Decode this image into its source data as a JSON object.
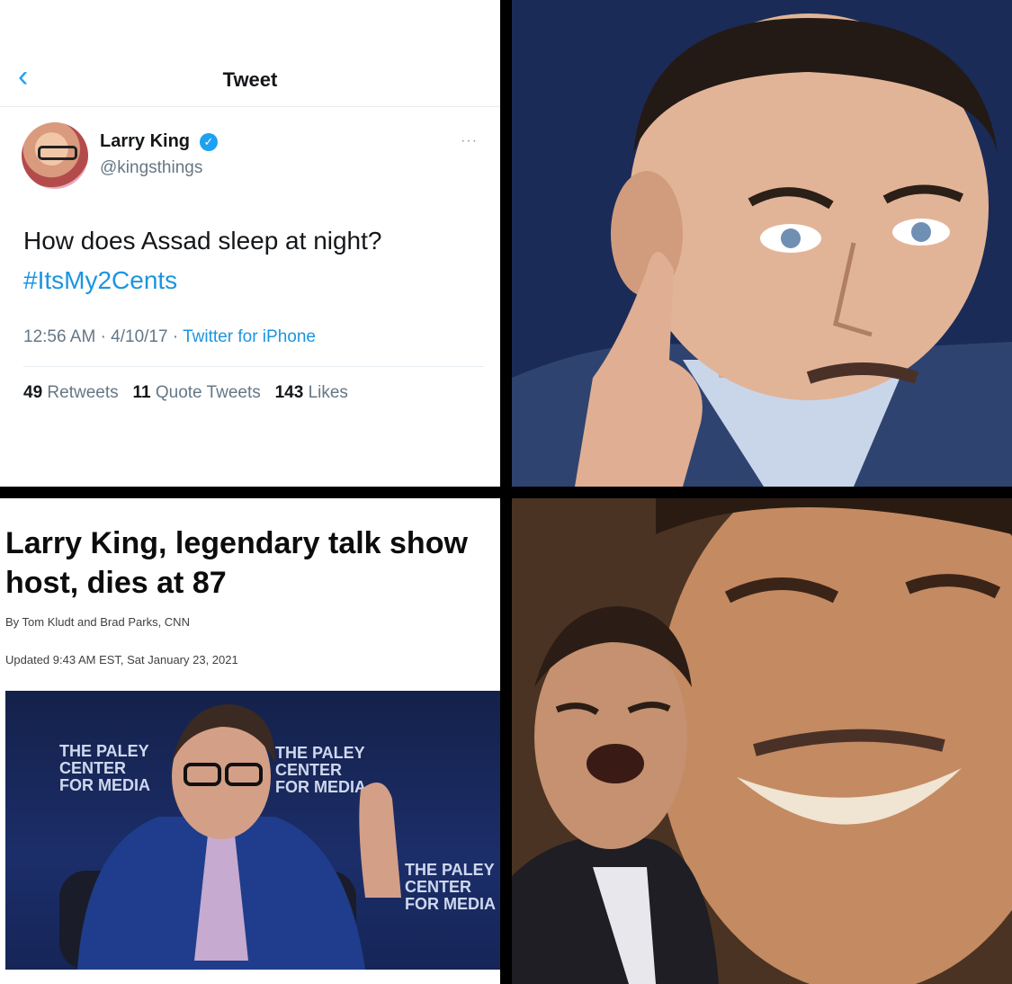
{
  "tweet": {
    "nav_title": "Tweet",
    "back_icon": "chevron-left-icon",
    "user_name": "Larry King",
    "verified_icon": "verified-badge-icon",
    "handle": "@kingsthings",
    "more_icon": "more-dots-icon",
    "more_glyph": "···",
    "text": "How does Assad sleep at night?",
    "hashtag": "#ItsMy2Cents",
    "time": "12:56 AM",
    "date": "4/10/17",
    "source": "Twitter for iPhone",
    "retweets_count": "49",
    "retweets_label": "Retweets",
    "quote_count": "11",
    "quote_label": "Quote Tweets",
    "likes_count": "143",
    "likes_label": "Likes",
    "accent_color": "#1da1f2"
  },
  "article": {
    "headline": "Larry King, legendary talk show host, dies at 87",
    "byline": "By Tom Kludt and Brad Parks, CNN",
    "updated": "Updated 9:43 AM EST, Sat January 23, 2021",
    "photo_logo_lines": [
      "THE PALEY",
      "CENTER",
      "FOR MEDIA"
    ]
  }
}
